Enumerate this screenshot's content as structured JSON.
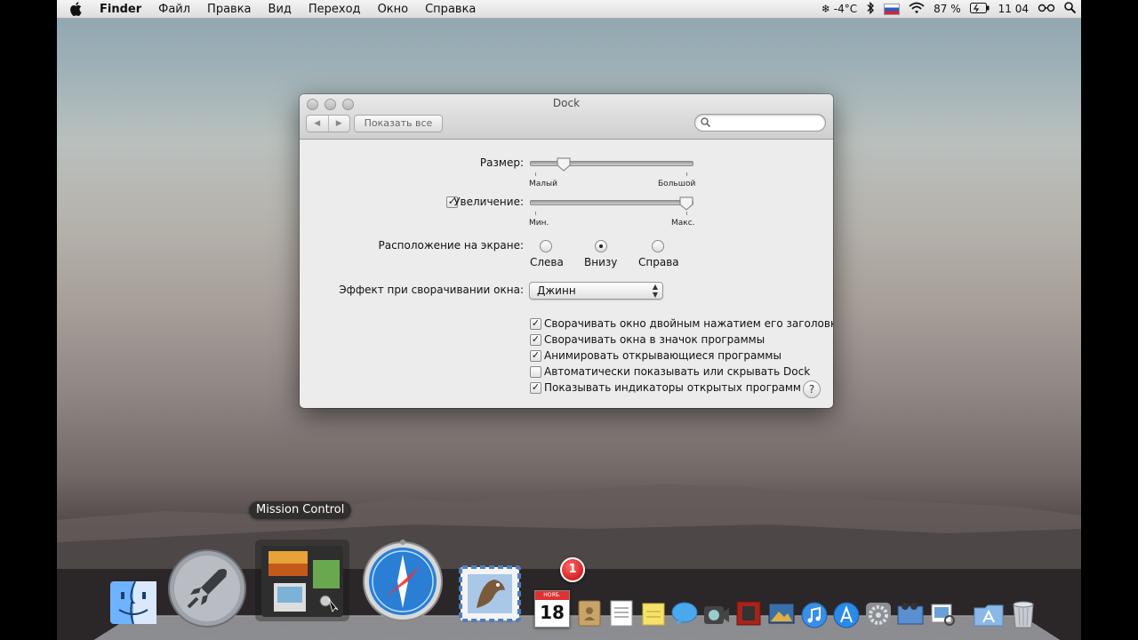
{
  "menubar": {
    "app_name": "Finder",
    "items": [
      "Файл",
      "Правка",
      "Вид",
      "Переход",
      "Окно",
      "Справка"
    ],
    "weather": "❄ -4°C",
    "battery": "87 %",
    "time": "11 04"
  },
  "window": {
    "title": "Dock",
    "show_all": "Показать все",
    "search_placeholder": "",
    "size": {
      "label": "Размер:",
      "min_label": "Малый",
      "max_label": "Большой",
      "value": 0.2
    },
    "magnification": {
      "label": "Увеличение:",
      "checked": true,
      "min_label": "Мин.",
      "max_label": "Макс.",
      "value": 1.0
    },
    "position": {
      "label": "Расположение на экране:",
      "options": [
        "Слева",
        "Внизу",
        "Справа"
      ],
      "selected": "Внизу"
    },
    "minimize_effect": {
      "label": "Эффект при сворачивании окна:",
      "value": "Джинн"
    },
    "checkboxes": [
      {
        "label": "Сворачивать окно двойным нажатием его заголовка",
        "checked": true
      },
      {
        "label": "Сворачивать окна в значок программы",
        "checked": true
      },
      {
        "label": "Анимировать открывающиеся программы",
        "checked": true
      },
      {
        "label": "Автоматически показывать или скрывать Dock",
        "checked": false
      },
      {
        "label": "Показывать индикаторы открытых программ",
        "checked": true
      }
    ],
    "help": "?"
  },
  "dock": {
    "tooltip": "Mission Control",
    "calendar_month": "НОЯБ.",
    "calendar_day": "18",
    "mail_badge": "1"
  },
  "colors": {
    "safari_blue": "#2a7fd4",
    "menubar_bg": "#ececec",
    "badge_red": "#d40000"
  }
}
